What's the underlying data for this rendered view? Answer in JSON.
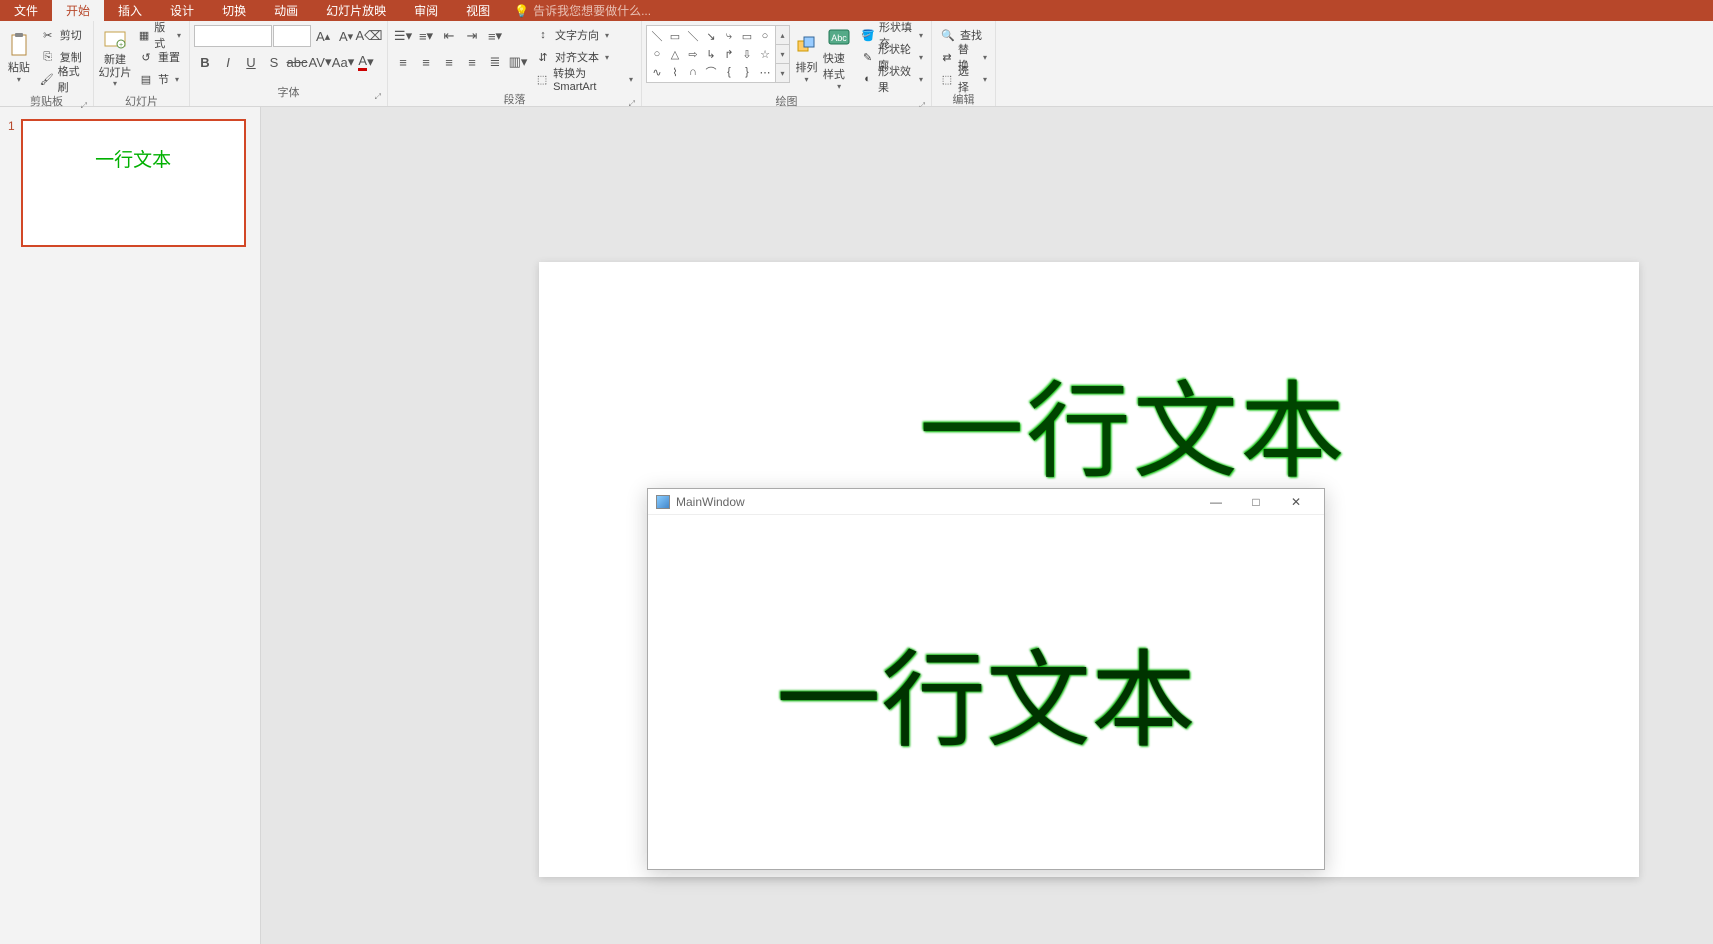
{
  "tabs": [
    "文件",
    "开始",
    "插入",
    "设计",
    "切换",
    "动画",
    "幻灯片放映",
    "审阅",
    "视图"
  ],
  "activeTab": "开始",
  "tellMe": {
    "placeholder": "告诉我您想要做什么..."
  },
  "ribbon": {
    "clipboard": {
      "label": "剪贴板",
      "paste": "粘贴",
      "cut": "剪切",
      "copy": "复制",
      "formatPainter": "格式刷"
    },
    "slides": {
      "label": "幻灯片",
      "newSlide": "新建\n幻灯片",
      "layout": "版式",
      "reset": "重置",
      "section": "节"
    },
    "font": {
      "label": "字体",
      "family": "",
      "size": ""
    },
    "paragraph": {
      "label": "段落",
      "textDirection": "文字方向",
      "alignText": "对齐文本",
      "smartArt": "转换为 SmartArt"
    },
    "drawing": {
      "label": "绘图",
      "arrange": "排列",
      "quickStyles": "快速样式",
      "shapeFill": "形状填充",
      "shapeOutline": "形状轮廓",
      "shapeEffects": "形状效果"
    },
    "editing": {
      "label": "编辑",
      "find": "查找",
      "replace": "替换",
      "select": "选择"
    }
  },
  "slides": [
    {
      "num": "1",
      "text": "一行文本"
    }
  ],
  "canvas": {
    "text": "一行文本"
  },
  "popup": {
    "title": "MainWindow",
    "text": "一行文本"
  }
}
